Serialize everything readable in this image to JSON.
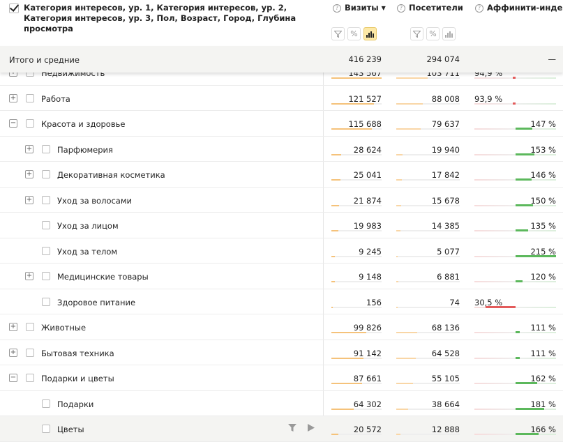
{
  "header": {
    "dimensions": "Категория интересов, ур. 1, Категория интересов, ур. 2, Категория интересов, ур. 3, Пол, Возраст, Город, Глубина просмотра",
    "metrics": [
      {
        "label": "Визиты",
        "sorted": true,
        "sort_icon": "▼"
      },
      {
        "label": "Посетители",
        "sorted": false
      },
      {
        "label": "Аффинити-индекс",
        "sorted": false
      }
    ],
    "help_icon": "?"
  },
  "totals": {
    "label": "Итого и средние",
    "visits": "416 239",
    "visitors": "294 074",
    "affinity": "—"
  },
  "colors": {
    "visits_bar": "#f5c27a",
    "visitors_bar": "#f9d6a6",
    "good": "#5cb85c",
    "bad": "#e35b5b",
    "track": "#eee"
  },
  "rows": [
    {
      "name": "Недвижимость",
      "level": 1,
      "expander": "+",
      "visits": "143 567",
      "visitors": "103 711",
      "affinity": "94,9 %",
      "visits_v": 143567,
      "visitors_v": 103711,
      "affinity_v": 94.9
    },
    {
      "name": "Работа",
      "level": 1,
      "expander": "+",
      "visits": "121 527",
      "visitors": "88 008",
      "affinity": "93,9 %",
      "visits_v": 121527,
      "visitors_v": 88008,
      "affinity_v": 93.9
    },
    {
      "name": "Красота и здоровье",
      "level": 1,
      "expander": "−",
      "visits": "115 688",
      "visitors": "79 637",
      "affinity": "147 %",
      "visits_v": 115688,
      "visitors_v": 79637,
      "affinity_v": 147
    },
    {
      "name": "Парфюмерия",
      "level": 2,
      "expander": "+",
      "visits": "28 624",
      "visitors": "19 940",
      "affinity": "153 %",
      "visits_v": 28624,
      "visitors_v": 19940,
      "affinity_v": 153
    },
    {
      "name": "Декоративная косметика",
      "level": 2,
      "expander": "+",
      "visits": "25 041",
      "visitors": "17 842",
      "affinity": "146 %",
      "visits_v": 25041,
      "visitors_v": 17842,
      "affinity_v": 146
    },
    {
      "name": "Уход за волосами",
      "level": 2,
      "expander": "+",
      "visits": "21 874",
      "visitors": "15 678",
      "affinity": "150 %",
      "visits_v": 21874,
      "visitors_v": 15678,
      "affinity_v": 150
    },
    {
      "name": "Уход за лицом",
      "level": 2,
      "expander": "",
      "visits": "19 983",
      "visitors": "14 385",
      "affinity": "135 %",
      "visits_v": 19983,
      "visitors_v": 14385,
      "affinity_v": 135
    },
    {
      "name": "Уход за телом",
      "level": 2,
      "expander": "",
      "visits": "9 245",
      "visitors": "5 077",
      "affinity": "215 %",
      "visits_v": 9245,
      "visitors_v": 5077,
      "affinity_v": 215
    },
    {
      "name": "Медицинские товары",
      "level": 2,
      "expander": "+",
      "visits": "9 148",
      "visitors": "6 881",
      "affinity": "120 %",
      "visits_v": 9148,
      "visitors_v": 6881,
      "affinity_v": 120
    },
    {
      "name": "Здоровое питание",
      "level": 2,
      "expander": "",
      "visits": "156",
      "visitors": "74",
      "affinity": "30,5 %",
      "visits_v": 156,
      "visitors_v": 74,
      "affinity_v": 30.5
    },
    {
      "name": "Животные",
      "level": 1,
      "expander": "+",
      "visits": "99 826",
      "visitors": "68 136",
      "affinity": "111 %",
      "visits_v": 99826,
      "visitors_v": 68136,
      "affinity_v": 111
    },
    {
      "name": "Бытовая техника",
      "level": 1,
      "expander": "+",
      "visits": "91 142",
      "visitors": "64 528",
      "affinity": "111 %",
      "visits_v": 91142,
      "visitors_v": 64528,
      "affinity_v": 111
    },
    {
      "name": "Подарки и цветы",
      "level": 1,
      "expander": "−",
      "visits": "87 661",
      "visitors": "55 105",
      "affinity": "162 %",
      "visits_v": 87661,
      "visitors_v": 55105,
      "affinity_v": 162
    },
    {
      "name": "Подарки",
      "level": 2,
      "expander": "",
      "visits": "64 302",
      "visitors": "38 664",
      "affinity": "181 %",
      "visits_v": 64302,
      "visitors_v": 38664,
      "affinity_v": 181
    },
    {
      "name": "Цветы",
      "level": 2,
      "expander": "",
      "visits": "20 572",
      "visitors": "12 888",
      "affinity": "166 %",
      "visits_v": 20572,
      "visitors_v": 12888,
      "affinity_v": 166,
      "hover": true,
      "row_icons": [
        "filter-icon",
        "play-icon"
      ]
    }
  ]
}
